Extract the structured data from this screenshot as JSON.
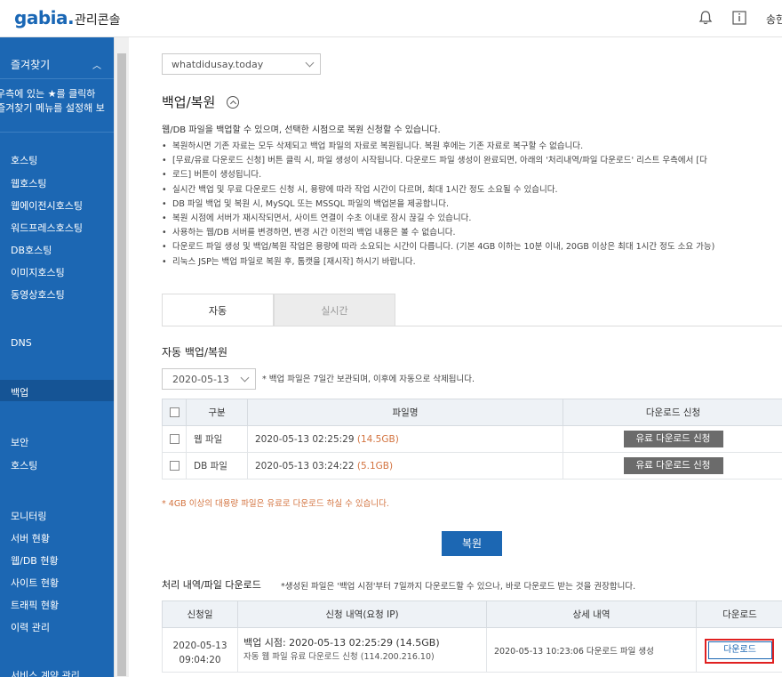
{
  "header": {
    "logo": "gabia.",
    "console_title": "관리콘솔",
    "user": "송현"
  },
  "sidebar": {
    "favorites": "즐겨찾기",
    "favorites_note_1": "우측에 있는 ★를 클릭하",
    "favorites_note_2": "즐겨찾기 메뉴를 설정해 보",
    "items": [
      {
        "label": "호스팅"
      },
      {
        "label": "웹호스팅"
      },
      {
        "label": "웹에이전시호스팅"
      },
      {
        "label": "워드프레스호스팅"
      },
      {
        "label": "DB호스팅"
      },
      {
        "label": "이미지호스팅"
      },
      {
        "label": "동영상호스팅"
      },
      {
        "label": "DNS"
      },
      {
        "label": "백업"
      },
      {
        "label": "보안"
      },
      {
        "label": "호스팅"
      },
      {
        "label": "모니터링"
      },
      {
        "label": "서버 현황"
      },
      {
        "label": "웹/DB 현황"
      },
      {
        "label": "사이트 현황"
      },
      {
        "label": "트래픽 현황"
      },
      {
        "label": "이력 관리"
      },
      {
        "label": "서비스 계약 관리"
      }
    ]
  },
  "main": {
    "site_select": "whatdidusay.today",
    "title": "백업/복원",
    "intro": "웹/DB 파일을 백업할 수 있으며, 선택한 시점으로 복원 신청할 수 있습니다.",
    "bullets": [
      "복원하시면 기존 자료는 모두 삭제되고 백업 파일의 자료로 복원됩니다. 복원 후에는 기존 자료로 복구할 수 없습니다.",
      "[무료/유료 다운로드 신청] 버튼 클릭 시, 파일 생성이 시작됩니다. 다운로드 파일 생성이 완료되면, 아래의 '처리내역/파일 다운로드' 리스트 우측에서 [다",
      "로드] 버튼이 생성됩니다.",
      "실시간 백업 및 무료 다운로드 신청 시, 용량에 따라 작업 시간이 다르며, 최대 1시간 정도 소요될 수 있습니다.",
      "DB 파일 백업 및 복원 시, MySQL 또는 MSSQL 파일의 백업본을 제공합니다.",
      "복원 시점에 서버가 재시작되면서, 사이트 연결이 수초 이내로 잠시 끊길 수 있습니다.",
      "사용하는 웹/DB 서버를 변경하면, 변경 시간 이전의 백업 내용은 볼 수 없습니다.",
      "다운로드 파일 생성 및 백업/복원 작업은 용량에 따라 소요되는 시간이 다릅니다. (기본 4GB 이하는 10분 이내, 20GB 이상은 최대 1시간 정도 소요 가능)",
      "리눅스 JSP는 백업 파일로 복원 후, 톰캣을 [재시작] 하시기 바랍니다."
    ],
    "tabs": [
      {
        "label": "자동"
      },
      {
        "label": "실시간"
      }
    ],
    "auto_section_title": "자동 백업/복원",
    "date_select": "2020-05-13",
    "date_note": "* 백업 파일은 7일간 보관되며, 이후에 자동으로 삭제됩니다.",
    "backup_table": {
      "headers": [
        "구분",
        "파일명",
        "다운로드 신청"
      ],
      "rows": [
        {
          "type": "웹 파일",
          "file": "2020-05-13 02:25:29",
          "size": "(14.5GB)",
          "action": "유료 다운로드 신청"
        },
        {
          "type": "DB 파일",
          "file": "2020-05-13 03:24:22",
          "size": "(5.1GB)",
          "action": "유료 다운로드 신청"
        }
      ]
    },
    "warning": "* 4GB 이상의 대용량 파일은 유료로 다운로드 하실 수 있습니다.",
    "restore_button": "복원",
    "history_title": "처리 내역/파일 다운로드",
    "history_note": "*생성된 파일은 '백업 시점'부터 7일까지 다운로드할 수 있으나, 바로 다운로드 받는 것을 권장합니다.",
    "history_table": {
      "headers": [
        "신청일",
        "신청 내역(요청 IP)",
        "상세 내역",
        "다운로드"
      ],
      "rows": [
        {
          "date": "2020-05-13",
          "time": "09:04:20",
          "request_line1": "백업 시점: 2020-05-13 02:25:29 (14.5GB)",
          "request_line2": "자동 웹 파일 유료 다운로드 신청 (114.200.216.10)",
          "detail": "2020-05-13 10:23:06 다운로드 파일 생성",
          "download": "다운로드"
        }
      ]
    }
  }
}
